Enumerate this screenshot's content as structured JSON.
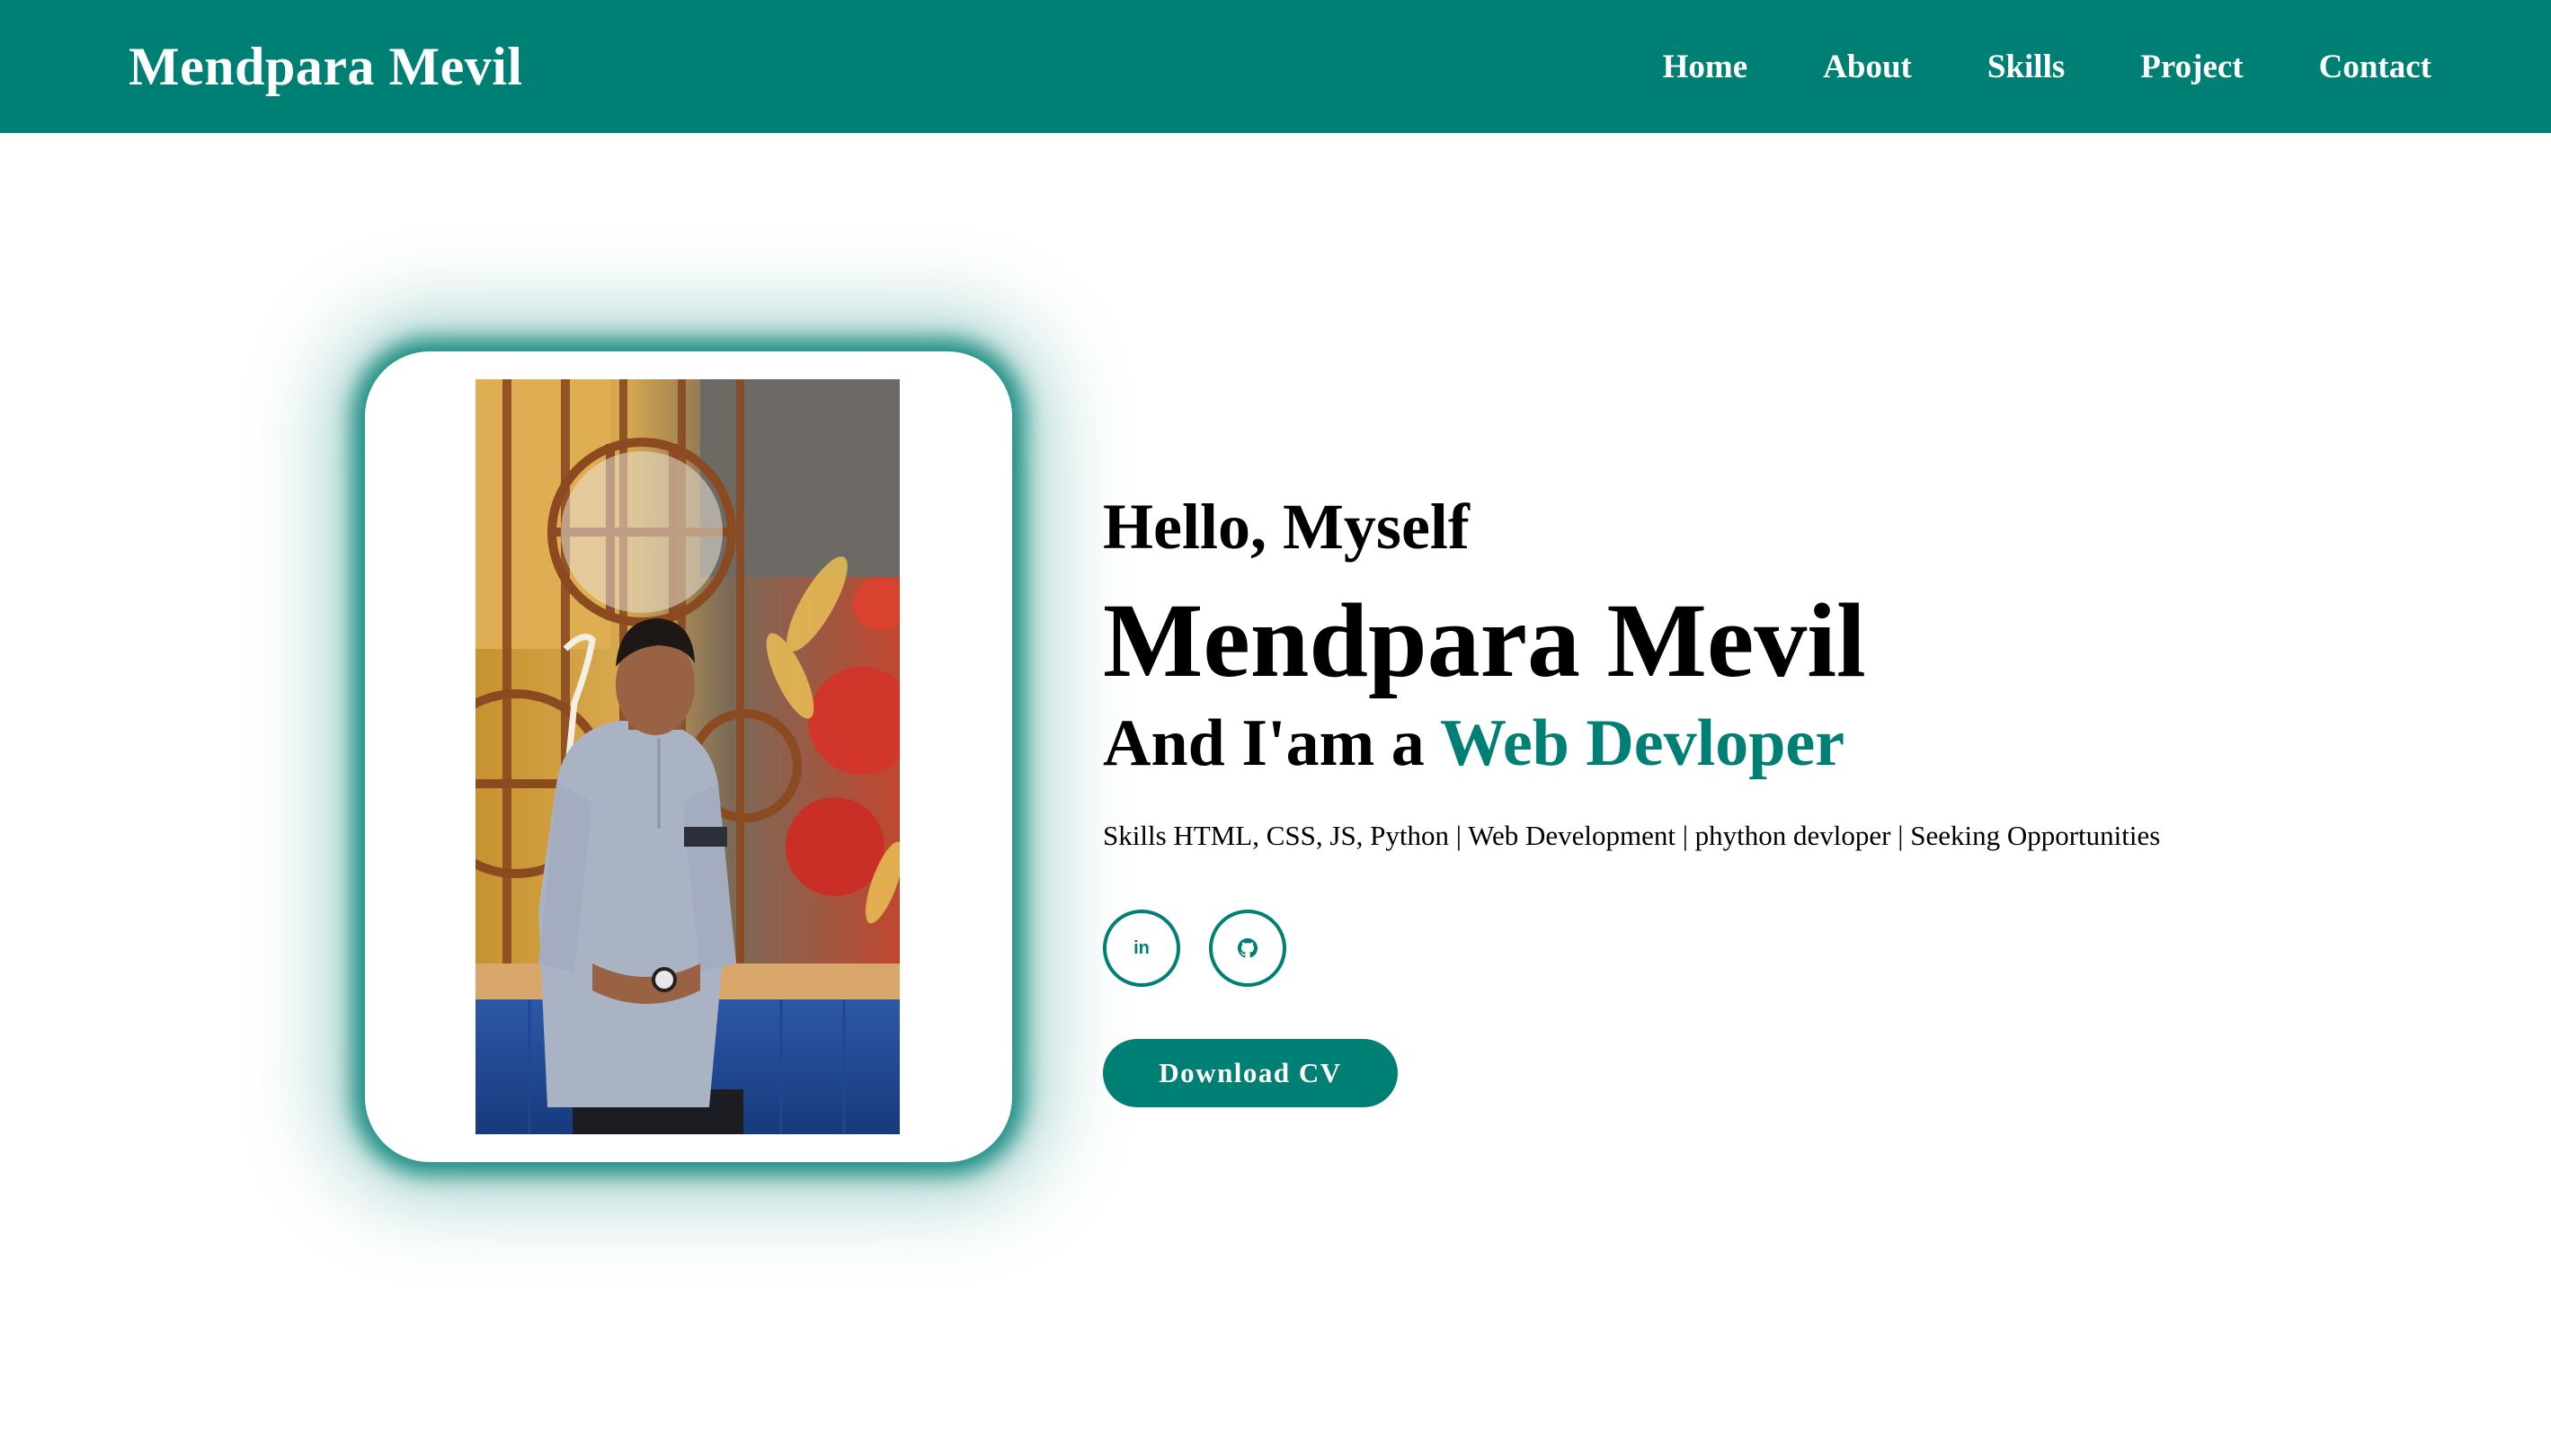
{
  "header": {
    "brand": "Mendpara Mevil",
    "nav": [
      {
        "label": "Home"
      },
      {
        "label": "About"
      },
      {
        "label": "Skills"
      },
      {
        "label": "Project"
      },
      {
        "label": "Contact"
      }
    ]
  },
  "hero": {
    "greeting": "Hello, Myself",
    "name": "Mendpara Mevil",
    "role_prefix": "And I'am a",
    "role": "Web Devloper",
    "tagline": "Skills HTML, CSS, JS, Python | Web Development | phython devloper | Seeking Opportunities",
    "social": [
      {
        "icon": "linkedin-icon",
        "glyph": "in"
      },
      {
        "icon": "github-icon"
      }
    ],
    "cv_button": "Download CV",
    "photo": "profile-photo"
  },
  "colors": {
    "accent": "#008074",
    "text": "#000000",
    "background": "#ffffff"
  }
}
